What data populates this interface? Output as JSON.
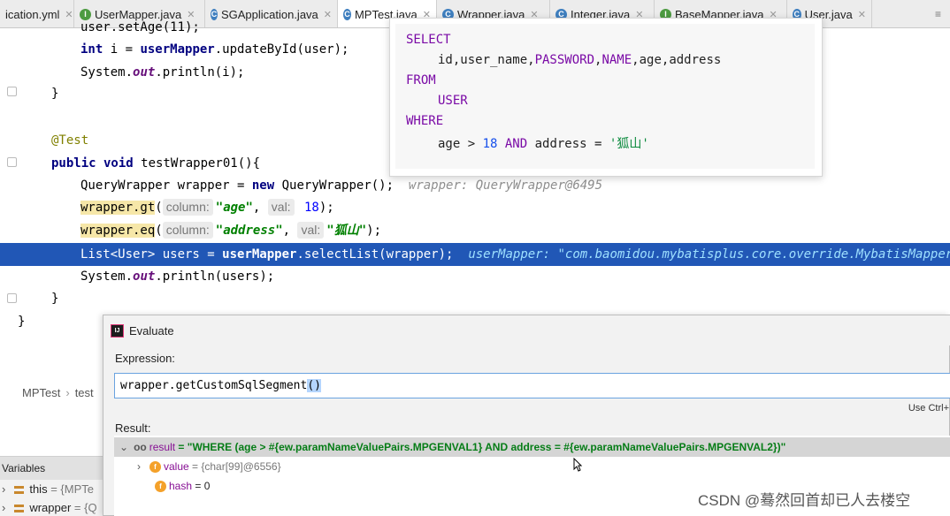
{
  "tabs": [
    {
      "label": "ication.yml",
      "icon": "yml-file-icon",
      "active": false
    },
    {
      "label": "UserMapper.java",
      "icon": "interface-icon",
      "active": false
    },
    {
      "label": "SGApplication.java",
      "icon": "class-icon",
      "active": false
    },
    {
      "label": "MPTest.java",
      "icon": "class-icon",
      "active": true
    },
    {
      "label": "Wrapper.java",
      "icon": "class-icon",
      "active": false
    },
    {
      "label": "Integer.java",
      "icon": "class-icon",
      "active": false
    },
    {
      "label": "BaseMapper.java",
      "icon": "interface-icon",
      "active": false
    },
    {
      "label": "User.java",
      "icon": "class-icon",
      "active": false
    }
  ],
  "code": {
    "l0": "user.setAge(11);",
    "l1a": "int",
    "l1b": " i = ",
    "l1c": "userMapper",
    "l1d": ".updateById(user);",
    "l2a": "System.",
    "l2b": "out",
    "l2c": ".println(i);",
    "l3": "}",
    "l5": "@Test",
    "l6a": "public void",
    "l6b": " testWrapper01(){",
    "l7a": "QueryWrapper wrapper = ",
    "l7b": "new",
    "l7c": " QueryWrapper();",
    "l7hint": "wrapper: QueryWrapper@6495",
    "l8a": "wrapper.gt",
    "l8b": "(",
    "l8p1": "column:",
    "l8s": "\"age\"",
    "l8c": ", ",
    "l8p2": "val:",
    "l8n": " 18",
    "l8d": ");",
    "l9a": "wrapper.eq",
    "l9b": "(",
    "l9p1": "column:",
    "l9s": "\"address\"",
    "l9c": ", ",
    "l9p2": "val:",
    "l9s2": "\"狐山\"",
    "l9d": ");",
    "l10a": "List<User> users = ",
    "l10b": "userMapper",
    "l10c": ".selectList(wrapper);",
    "l10hint": "userMapper: \"com.baomidou.mybatisplus.core.override.MybatisMapperProxy@...",
    "l11a": "System.",
    "l11b": "out",
    "l11c": ".println(users);",
    "l12": "}",
    "l13": "}"
  },
  "sql_popup": {
    "select": "SELECT",
    "columns_a": "id,user_name,",
    "columns_b": "PASSWORD",
    "columns_c": ",",
    "columns_d": "NAME",
    "columns_e": ",age,address",
    "from": "FROM",
    "table": "USER",
    "where": "WHERE",
    "cond_a": "age > ",
    "cond_num": "18",
    "cond_and": " AND ",
    "cond_b": "address = ",
    "cond_str": "'狐山'"
  },
  "breadcrumb": {
    "a": "MPTest",
    "b": "test"
  },
  "variables": {
    "title": "Variables",
    "rows": [
      {
        "name": "this",
        "value": " = {MPTe"
      },
      {
        "name": "wrapper",
        "value": " = {Q"
      }
    ]
  },
  "evaluate": {
    "title": "Evaluate",
    "expression_label": "Expression:",
    "expression_a": "wrapper.getCustomSqlSegment",
    "expression_b": "()",
    "use_ctrl": "Use Ctrl+",
    "result_label": "Result:",
    "result_key": "result",
    "result_value": " = \"WHERE (age > #{ew.paramNameValuePairs.MPGENVAL1} AND address = #{ew.paramNameValuePairs.MPGENVAL2})\"",
    "child1_key": "value",
    "child1_val": " = {char[99]@6556}",
    "child2_key": "hash",
    "child2_val": " = 0"
  },
  "watermark": "CSDN @蓦然回首却已人去楼空",
  "colors": {
    "selection": "#2157b6",
    "keyword": "#000080",
    "string": "#008000",
    "sql_keyword": "#7a0aa6"
  }
}
